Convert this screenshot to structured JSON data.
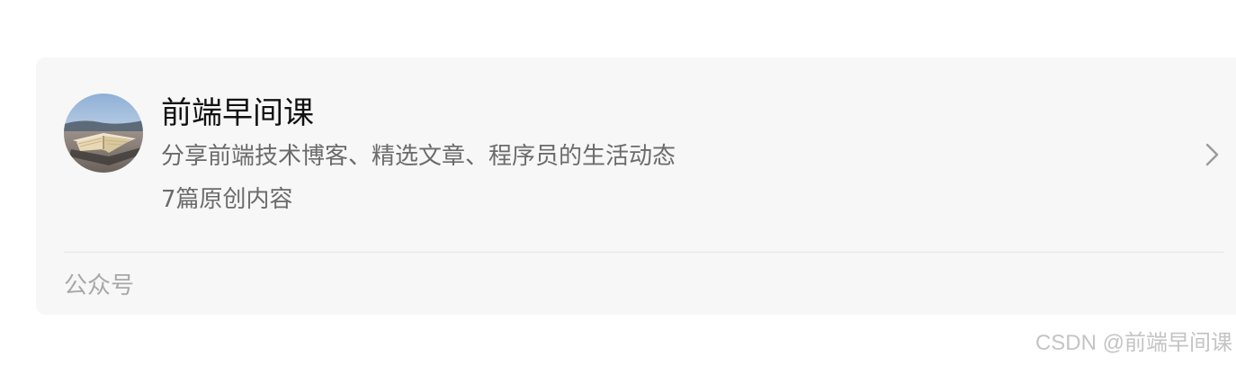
{
  "account_card": {
    "name": "前端早间课",
    "description": "分享前端技术博客、精选文章、程序员的生活动态",
    "article_count": "7篇原创内容",
    "type_label": "公众号",
    "avatar_icon": "open-book-photo",
    "chevron_icon": "chevron-right-icon"
  },
  "watermark": {
    "text": "CSDN @前端早间课"
  }
}
